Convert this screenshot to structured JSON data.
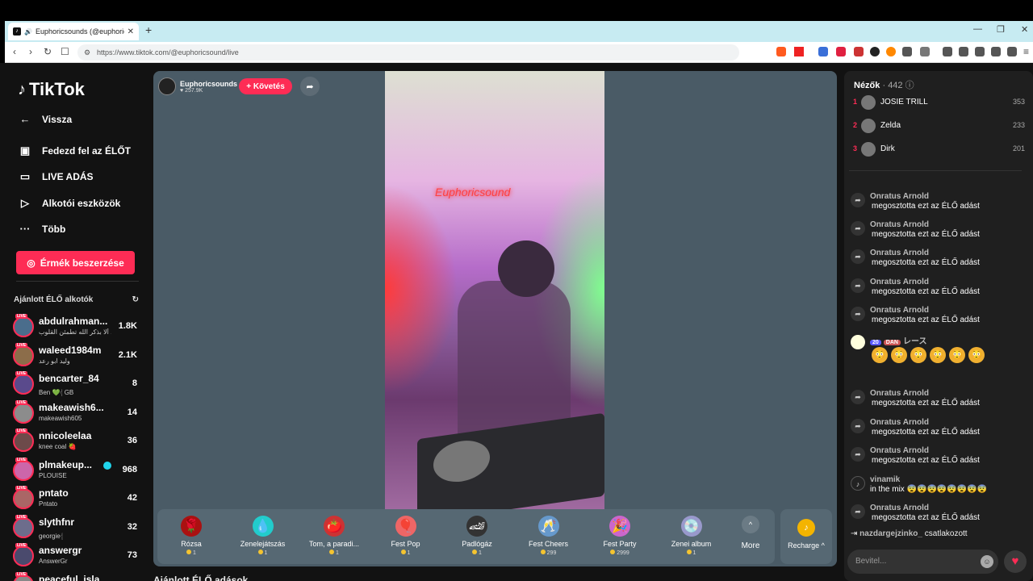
{
  "browser": {
    "tab_title": "Euphoricsounds (@euphoricsc",
    "url": "https://www.tiktok.com/@euphoricsound/live"
  },
  "sidebar": {
    "logo": "TikTok",
    "nav": [
      {
        "label": "Vissza",
        "icon": "arrow-left-icon"
      },
      {
        "label": "Fedezd fel az ÉLŐT",
        "icon": "live-tv-icon"
      },
      {
        "label": "LIVE ADÁS",
        "icon": "video-camera-icon"
      },
      {
        "label": "Alkotói eszközök",
        "icon": "creator-tools-icon"
      },
      {
        "label": "Több",
        "icon": "more-dots-icon"
      }
    ],
    "coins_button": "Érmék beszerzése",
    "recommended_title": "Ajánlott ÉLŐ alkotók",
    "creators": [
      {
        "name": "abdulrahman...",
        "sub": "ألا بذكر الله تطمئن القلوب ...",
        "count": "1.8K"
      },
      {
        "name": "waleed1984m",
        "sub": "وليد ابو رعد",
        "count": "2.1K"
      },
      {
        "name": "bencarter_84",
        "sub": "Ben 💚𓂆 GB",
        "count": "8"
      },
      {
        "name": "makeawish6...",
        "sub": "makeawish605",
        "count": "14"
      },
      {
        "name": "nnicoleelaa",
        "sub": "knee coal 🍓",
        "count": "36"
      },
      {
        "name": "plmakeup...",
        "sub": "PLOUISE",
        "count": "968",
        "verified": true
      },
      {
        "name": "pntato",
        "sub": "Pntato",
        "count": "42"
      },
      {
        "name": "slythfnr",
        "sub": "georgie𓂆",
        "count": "32"
      },
      {
        "name": "answergr",
        "sub": "AnswerGr",
        "count": "73"
      },
      {
        "name": "peaceful_isla",
        "sub": "",
        "count": ""
      }
    ]
  },
  "stage": {
    "host_name": "Euphoricsounds",
    "host_likes": "257.9K",
    "follow_label": "+ Követés",
    "video_neon_text": "Euphoricsound",
    "gifts": [
      {
        "name": "Rózsa",
        "price": "1",
        "icon": "🌹"
      },
      {
        "name": "Zenelejátszás",
        "price": "1",
        "icon": "💧"
      },
      {
        "name": "Tom, a paradi...",
        "price": "1",
        "icon": "🍅"
      },
      {
        "name": "Fest Pop",
        "price": "1",
        "icon": "🎈"
      },
      {
        "name": "Padlógáz",
        "price": "1",
        "icon": "🏎"
      },
      {
        "name": "Fest Cheers",
        "price": "299",
        "icon": "🥂"
      },
      {
        "name": "Fest Party",
        "price": "2999",
        "icon": "🎉"
      },
      {
        "name": "Zenei album",
        "price": "1",
        "icon": "💿"
      }
    ],
    "more_label": "More",
    "recharge_label": "Recharge ^",
    "below_label": "Ajánlott ÉLŐ adások"
  },
  "chat": {
    "viewers_label": "Nézők",
    "viewers_count": "· 442",
    "top": [
      {
        "rank": "1",
        "name": "JOSIE TRILL",
        "score": "353"
      },
      {
        "rank": "2",
        "name": "Zelda",
        "score": "233"
      },
      {
        "rank": "3",
        "name": "Dirk",
        "score": "201"
      }
    ],
    "share_user": "Onratus Arnold",
    "share_text": "megosztotta ezt az ÉLŐ adást",
    "badge_level": "20",
    "badge_dan": "DAN",
    "special_user": "レース",
    "vinamik_user": "vinamik",
    "vinamik_text": "in the mix 😨😨😨😨😨😨😨😨",
    "join_user": "nazdargejzinko_",
    "join_text": "csatlakozott",
    "input_placeholder": "Bevitel..."
  }
}
